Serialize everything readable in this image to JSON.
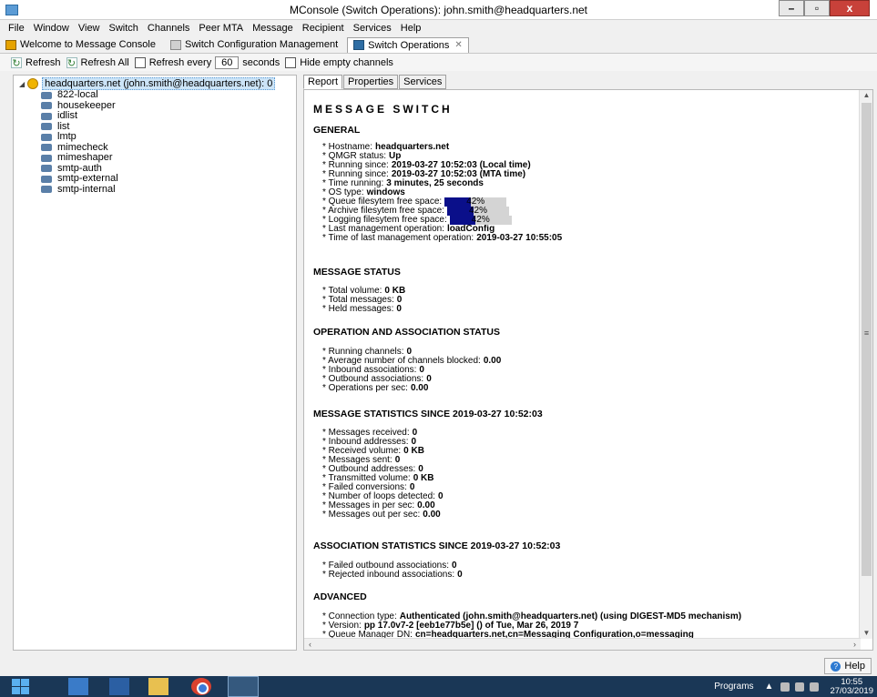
{
  "window": {
    "title": "MConsole (Switch Operations): john.smith@headquarters.net",
    "controls": [
      "–",
      "▫",
      "x"
    ]
  },
  "menu": [
    "File",
    "Window",
    "View",
    "Switch",
    "Channels",
    "Peer MTA",
    "Message",
    "Recipient",
    "Services",
    "Help"
  ],
  "tabs": [
    {
      "label": "Welcome to Message Console",
      "icon": "home-icon"
    },
    {
      "label": "Switch Configuration Management",
      "icon": "config-icon"
    },
    {
      "label": "Switch Operations",
      "icon": "operations-icon",
      "active": true
    }
  ],
  "toolbar": {
    "refresh": "Refresh",
    "refresh_all": "Refresh All",
    "refresh_every": "Refresh every",
    "interval": "60",
    "seconds": "seconds",
    "hide_empty": "Hide empty channels"
  },
  "tree": {
    "root": "headquarters.net (john.smith@headquarters.net): 0",
    "channels": [
      "822-local",
      "housekeeper",
      "idlist",
      "list",
      "lmtp",
      "mimecheck",
      "mimeshaper",
      "smtp-auth",
      "smtp-external",
      "smtp-internal"
    ]
  },
  "report_tabs": [
    "Report",
    "Properties",
    "Services"
  ],
  "report": {
    "heading": "MESSAGE SWITCH",
    "general": {
      "title": "GENERAL",
      "hostname_label": "* Hostname:",
      "hostname": "headquarters.net",
      "qmgr_label": "* QMGR status:",
      "qmgr": "Up",
      "running_local_label": "* Running since:",
      "running_local": "2019-03-27 10:52:03 (Local time)",
      "running_mta_label": "* Running since:",
      "running_mta": "2019-03-27 10:52:03 (MTA time)",
      "time_running_label": "* Time running:",
      "time_running": "3 minutes, 25 seconds",
      "os_label": "* OS type:",
      "os": "windows",
      "queue_fs_label": "* Queue filesytem free space:",
      "queue_fs": "42%",
      "queue_fs_used": 0.42,
      "archive_fs_label": "* Archive filesytem free space:",
      "archive_fs": "42%",
      "archive_fs_used": 0.42,
      "logging_fs_label": "* Logging filesytem free space:",
      "logging_fs": "42%",
      "logging_fs_used": 0.42,
      "last_op_label": "* Last management operation:",
      "last_op": "loadConfig",
      "last_op_time_label": "* Time of last management operation:",
      "last_op_time": "2019-03-27 10:55:05"
    },
    "message_status": {
      "title": "MESSAGE STATUS",
      "volume_label": "* Total volume:",
      "volume": "0 KB",
      "messages_label": "* Total messages:",
      "messages": "0",
      "held_label": "* Held messages:",
      "held": "0"
    },
    "operation": {
      "title": "OPERATION AND ASSOCIATION STATUS",
      "running_label": "* Running channels:",
      "running": "0",
      "blocked_label": "* Average number of channels blocked:",
      "blocked": "0.00",
      "inbound_label": "* Inbound associations:",
      "inbound": "0",
      "outbound_label": "* Outbound associations:",
      "outbound": "0",
      "ops_label": "* Operations per sec:",
      "ops": "0.00"
    },
    "msg_stats": {
      "title": "MESSAGE STATISTICS SINCE 2019-03-27 10:52:03",
      "received_label": "* Messages received:",
      "received": "0",
      "inbound_addr_label": "* Inbound addresses:",
      "inbound_addr": "0",
      "received_vol_label": "* Received volume:",
      "received_vol": "0 KB",
      "sent_label": "* Messages sent:",
      "sent": "0",
      "outbound_addr_label": "* Outbound addresses:",
      "outbound_addr": "0",
      "transmitted_label": "* Transmitted volume:",
      "transmitted": "0 KB",
      "failed_conv_label": "* Failed conversions:",
      "failed_conv": "0",
      "loops_label": "* Number of loops detected:",
      "loops": "0",
      "in_rate_label": "* Messages in per sec:",
      "in_rate": "0.00",
      "out_rate_label": "* Messages out per sec:",
      "out_rate": "0.00"
    },
    "assoc_stats": {
      "title": "ASSOCIATION STATISTICS SINCE 2019-03-27 10:52:03",
      "failed_out_label": "* Failed outbound associations:",
      "failed_out": "0",
      "rejected_in_label": "* Rejected inbound associations:",
      "rejected_in": "0"
    },
    "advanced": {
      "title": "ADVANCED",
      "conn_label": "* Connection type:",
      "conn": "Authenticated (john.smith@headquarters.net) (using DIGEST-MD5 mechanism)",
      "version_label": "* Version:",
      "version": "pp 17.0v7-2 [eeb1e77b5e] () of Tue, Mar 26, 2019  7",
      "qmdn_label": "* Queue Manager DN:",
      "qmdn": "cn=headquarters.net,cn=Messaging Configuration,o=messaging"
    }
  },
  "help": "Help",
  "taskbar": {
    "programs": "Programs",
    "time": "10:55",
    "date": "27/03/2019"
  }
}
